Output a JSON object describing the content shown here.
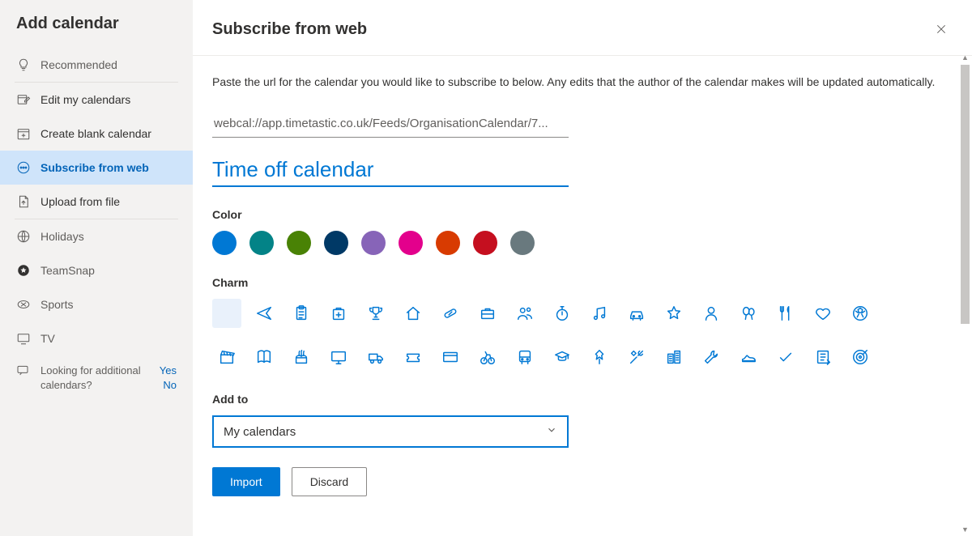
{
  "sidebar": {
    "title": "Add calendar",
    "recommended": "Recommended",
    "edit": "Edit my calendars",
    "create": "Create blank calendar",
    "subscribe": "Subscribe from web",
    "upload": "Upload from file",
    "holidays": "Holidays",
    "teamsnap": "TeamSnap",
    "sports": "Sports",
    "tv": "TV",
    "feedback_text": "Looking for additional calendars?",
    "feedback_yes": "Yes",
    "feedback_no": "No"
  },
  "header": {
    "title": "Subscribe from web"
  },
  "main": {
    "description": "Paste the url for the calendar you would like to subscribe to below. Any edits that the author of the calendar makes will be updated automatically.",
    "url_value": "webcal://app.timetastic.co.uk/Feeds/OrganisationCalendar/7...",
    "name_value": "Time off calendar",
    "color_label": "Color",
    "charm_label": "Charm",
    "addto_label": "Add to",
    "addto_selected": "My calendars",
    "import_label": "Import",
    "discard_label": "Discard"
  },
  "colors": [
    "#0078d4",
    "#038387",
    "#498205",
    "#003966",
    "#8764b8",
    "#e3008c",
    "#d83b01",
    "#c50f1f",
    "#69797e"
  ],
  "charms": [
    "none",
    "airplane",
    "clipboard",
    "medical",
    "trophy",
    "house",
    "pill",
    "briefcase",
    "people",
    "stopwatch",
    "music",
    "car",
    "star",
    "person",
    "balloons",
    "fork-knife",
    "heart",
    "soccer",
    "clapperboard",
    "book",
    "cake",
    "monitor",
    "truck",
    "ticket",
    "card",
    "bicycle",
    "bus",
    "graduation",
    "pin",
    "tools",
    "buildings",
    "wrench",
    "shoe",
    "checkmark",
    "note",
    "target"
  ]
}
